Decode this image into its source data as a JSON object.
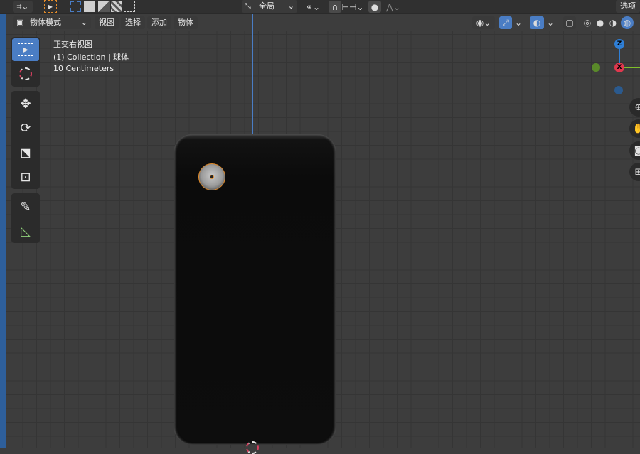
{
  "topbar": {
    "orientation_label": "全局",
    "options_label": "选项"
  },
  "header": {
    "mode_label": "物体模式",
    "menu": [
      "视图",
      "选择",
      "添加",
      "物体"
    ]
  },
  "overlay": {
    "view_name": "正交右视图",
    "collection": "(1) Collection | 球体",
    "scale": "10 Centimeters"
  },
  "gizmo": {
    "z_label": "Z",
    "x_label": "X",
    "colors": {
      "z": "#2f7fd6",
      "x": "#e0384e",
      "y": "#7fbf2a"
    }
  },
  "colors": {
    "accent": "#4a7dc4",
    "phone_body": "#0c0c0c",
    "selection_outline": "#e08a2a"
  }
}
